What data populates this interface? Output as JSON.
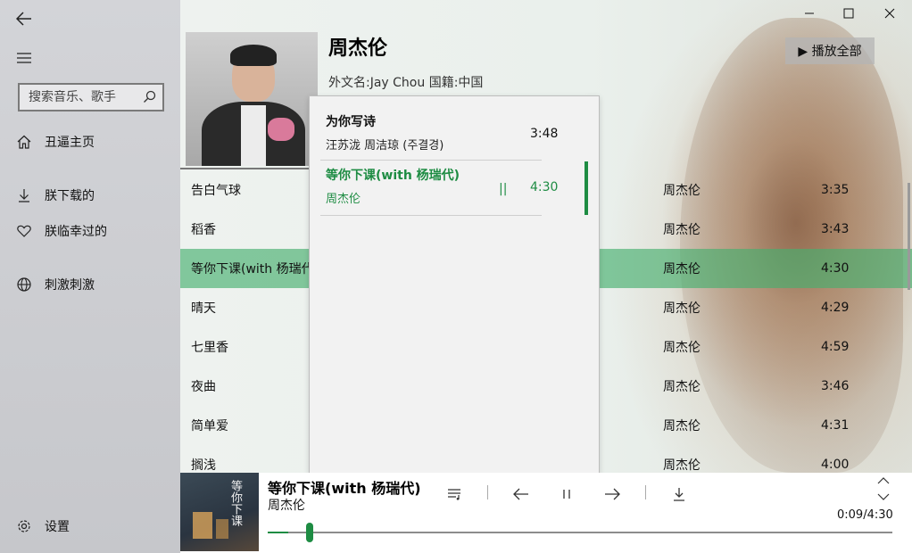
{
  "sidebar": {
    "search_placeholder": "搜索音乐、歌手",
    "nav": [
      {
        "label": "丑逼主页",
        "icon": "home-icon"
      },
      {
        "label": "朕下载的",
        "icon": "download-icon"
      },
      {
        "label": "朕临幸过的",
        "icon": "heart-icon"
      },
      {
        "label": "刺激刺激",
        "icon": "globe-icon"
      }
    ],
    "settings_label": "设置"
  },
  "artist": {
    "name": "周杰伦",
    "info": "外文名:Jay Chou 国籍:中国",
    "play_all_label": "▶ 播放全部"
  },
  "songs": [
    {
      "title": "告白气球",
      "artist": "周杰伦",
      "duration": "3:35"
    },
    {
      "title": "稻香",
      "artist": "周杰伦",
      "duration": "3:43"
    },
    {
      "title": "等你下课(with 杨瑞代",
      "artist": "周杰伦",
      "duration": "4:30"
    },
    {
      "title": "晴天",
      "artist": "周杰伦",
      "duration": "4:29"
    },
    {
      "title": "七里香",
      "artist": "周杰伦",
      "duration": "4:59"
    },
    {
      "title": "夜曲",
      "artist": "周杰伦",
      "duration": "3:46"
    },
    {
      "title": "简单爱",
      "artist": "周杰伦",
      "duration": "4:31"
    },
    {
      "title": "搁浅",
      "artist": "周杰伦",
      "duration": "4:00"
    }
  ],
  "queue": [
    {
      "title": "为你写诗",
      "artist": "汪苏泷 周洁琼 (주결경)",
      "duration": "3:48"
    },
    {
      "title": "等你下课(with 杨瑞代)",
      "artist": "周杰伦",
      "duration": "4:30",
      "pause_glyph": "||"
    }
  ],
  "player": {
    "title": "等你下课(with 杨瑞代)",
    "artist": "周杰伦",
    "time": "0:09/4:30",
    "progress": 0.033,
    "cover_text": "等你下课"
  },
  "colors": {
    "accent": "#1e8c43",
    "sidebar_bg": "#cdced2"
  }
}
